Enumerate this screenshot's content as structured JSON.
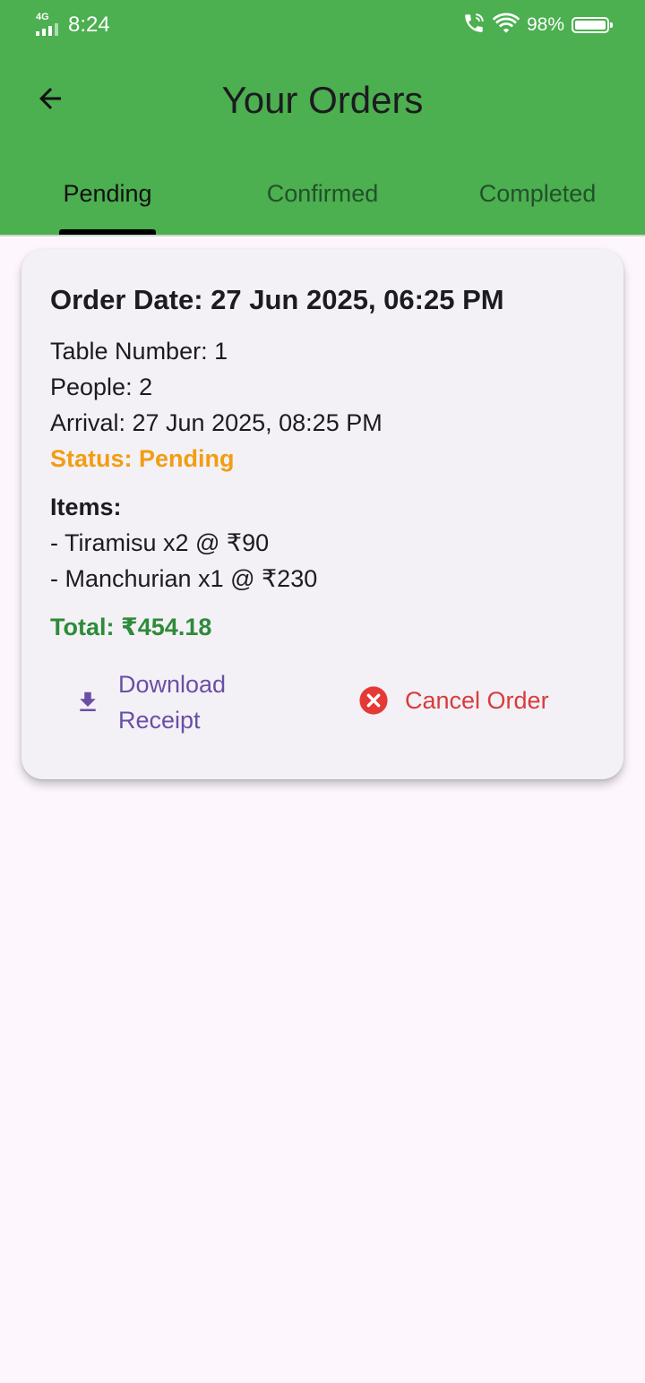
{
  "status_bar": {
    "network": "4G",
    "time": "8:24",
    "battery": "98%"
  },
  "appbar": {
    "title": "Your Orders"
  },
  "tabs": [
    {
      "label": "Pending",
      "active": true
    },
    {
      "label": "Confirmed",
      "active": false
    },
    {
      "label": "Completed",
      "active": false
    }
  ],
  "order": {
    "order_date": "Order Date: 27 Jun 2025, 06:25 PM",
    "table_number": "Table Number: 1",
    "people": "People: 2",
    "arrival": "Arrival: 27 Jun 2025, 08:25 PM",
    "status": "Status: Pending",
    "items_heading": "Items:",
    "items": [
      "- Tiramisu x2 @ ₹90",
      "- Manchurian x1 @ ₹230"
    ],
    "total": "Total: ₹454.18",
    "download_label": "Download Receipt",
    "cancel_label": "Cancel Order"
  },
  "colors": {
    "appbar_bg": "#4caf50",
    "status_pending": "#f29d12",
    "total_green": "#2e8b38",
    "download_purple": "#6a4fa5",
    "cancel_red": "#d93b3b"
  },
  "icons": {
    "back": "arrow-left-icon",
    "download": "download-icon",
    "cancel": "cancel-circle-icon"
  }
}
